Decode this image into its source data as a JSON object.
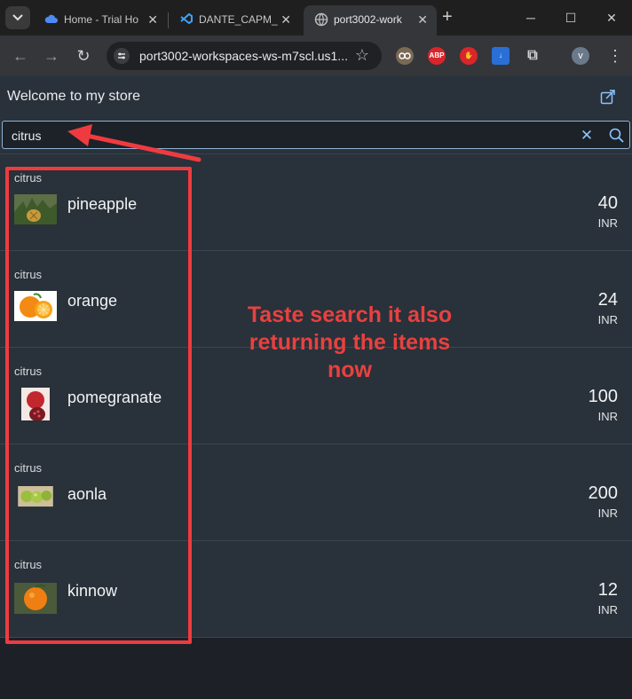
{
  "browser": {
    "tabs": [
      {
        "label": "Home - Trial Ho",
        "icon": "cloud-icon"
      },
      {
        "label": "DANTE_CAPM_",
        "icon": "vscode-icon"
      },
      {
        "label": "port3002-work",
        "icon": "globe-icon",
        "active": true
      }
    ],
    "url": "port3002-workspaces-ws-m7scl.us1...",
    "profile_initial": "v",
    "extensions": [
      "reader-icon",
      "adblock-icon",
      "stop-extension-icon",
      "download-extension-icon",
      "puzzle-icon"
    ],
    "extension_labels": {
      "adblock": "ABP"
    }
  },
  "app": {
    "title": "Welcome to my store",
    "search": {
      "value": "citrus"
    },
    "items": [
      {
        "category": "citrus",
        "name": "pineapple",
        "price": "40",
        "currency": "INR"
      },
      {
        "category": "citrus",
        "name": "orange",
        "price": "24",
        "currency": "INR"
      },
      {
        "category": "citrus",
        "name": "pomegranate",
        "price": "100",
        "currency": "INR"
      },
      {
        "category": "citrus",
        "name": "aonla",
        "price": "200",
        "currency": "INR"
      },
      {
        "category": "citrus",
        "name": "kinnow",
        "price": "12",
        "currency": "INR"
      }
    ]
  },
  "annotation": {
    "text": "Taste search it also returning the items now",
    "color": "#ef3b40"
  },
  "colors": {
    "accent": "#8dc5ff",
    "app_bg": "#29313a",
    "annotation": "#ef3b40"
  }
}
